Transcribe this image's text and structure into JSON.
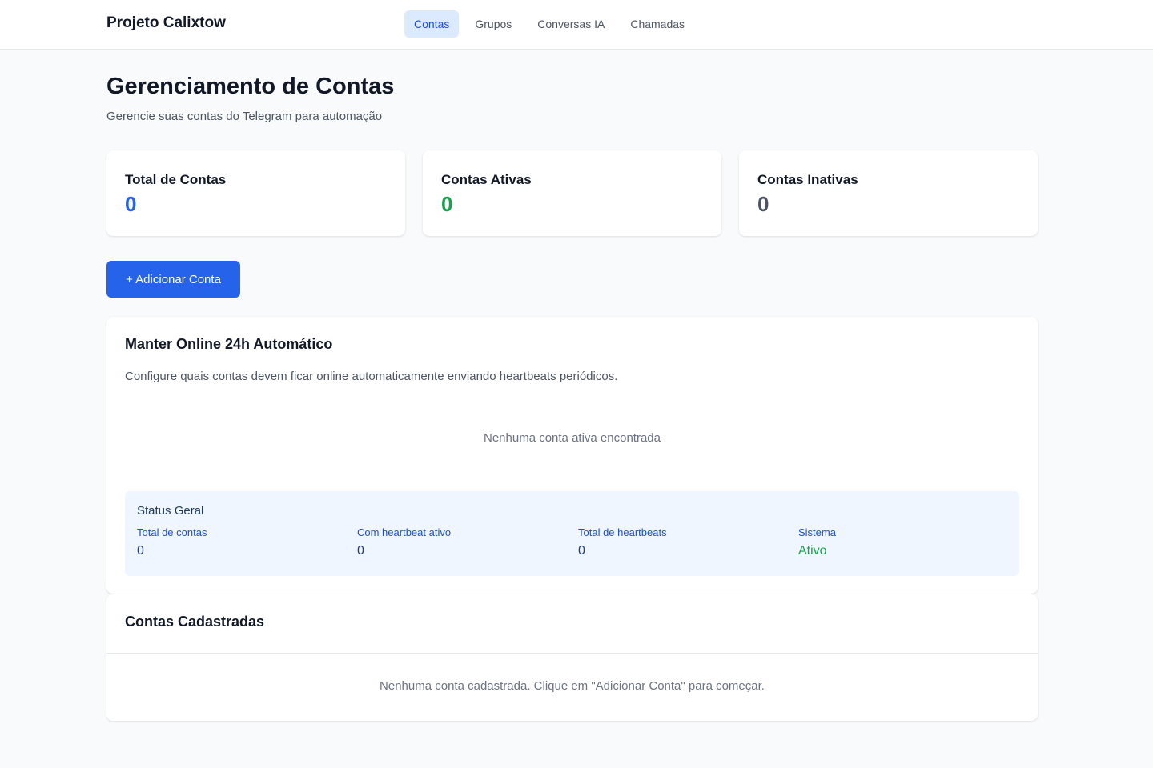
{
  "nav": {
    "brand": "Projeto Calixtow",
    "links": [
      {
        "label": "Contas",
        "active": true
      },
      {
        "label": "Grupos",
        "active": false
      },
      {
        "label": "Conversas IA",
        "active": false
      },
      {
        "label": "Chamadas",
        "active": false
      }
    ]
  },
  "page": {
    "title": "Gerenciamento de Contas",
    "subtitle": "Gerencie suas contas do Telegram para automação"
  },
  "stats": [
    {
      "label": "Total de Contas",
      "value": "0",
      "color": "#2563eb"
    },
    {
      "label": "Contas Ativas",
      "value": "0",
      "color": "#16a34a"
    },
    {
      "label": "Contas Inativas",
      "value": "0",
      "color": "#4b5563"
    }
  ],
  "actions": {
    "add_account": "+ Adicionar Conta"
  },
  "keep_online": {
    "title": "Manter Online 24h Automático",
    "description": "Configure quais contas devem ficar online automaticamente enviando heartbeats periódicos.",
    "empty": "Nenhuma conta ativa encontrada",
    "status": {
      "title": "Status Geral",
      "items": [
        {
          "label": "Total de contas",
          "value": "0"
        },
        {
          "label": "Com heartbeat ativo",
          "value": "0"
        },
        {
          "label": "Total de heartbeats",
          "value": "0"
        },
        {
          "label": "Sistema",
          "value": "Ativo"
        }
      ]
    }
  },
  "registered": {
    "title": "Contas Cadastradas",
    "empty": "Nenhuma conta cadastrada. Clique em \"Adicionar Conta\" para começar."
  }
}
